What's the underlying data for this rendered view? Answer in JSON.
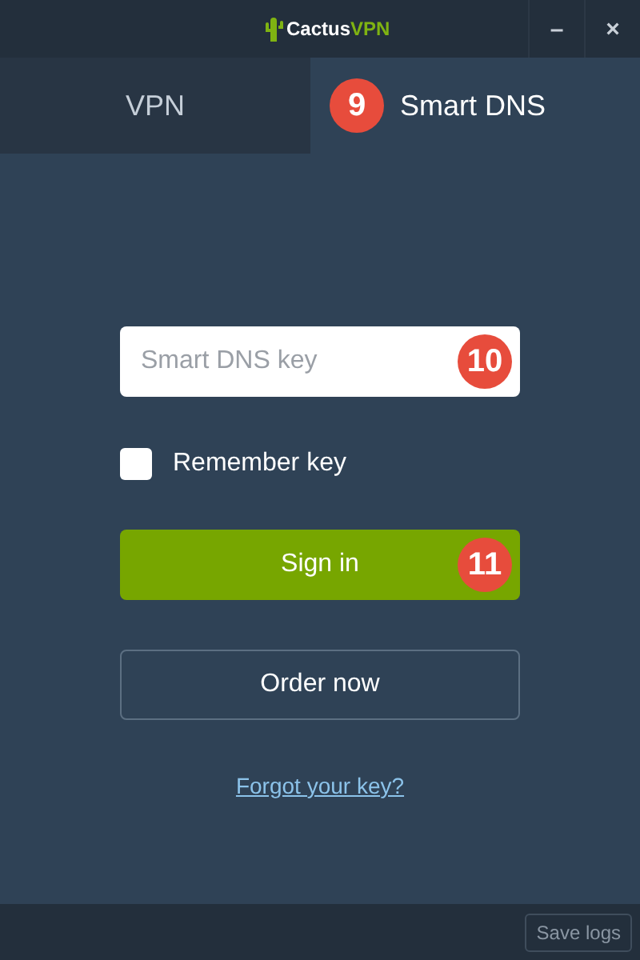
{
  "window": {
    "logo": [
      "Cactus",
      "VPN"
    ],
    "minimize": "–",
    "close": "×"
  },
  "tabs": [
    {
      "label": "VPN",
      "selected": false
    },
    {
      "label": "Smart DNS",
      "selected": true,
      "marker": "9"
    }
  ],
  "key_field": {
    "placeholder": "Smart DNS key",
    "marker": "10"
  },
  "remember": {
    "label": "Remember key",
    "checked": false
  },
  "sign_in": {
    "label": "Sign in",
    "marker": "11"
  },
  "order": {
    "label": "Order now"
  },
  "forgot": {
    "label": "Forgot your key?"
  },
  "footer": {
    "save_logs": "Save logs"
  }
}
